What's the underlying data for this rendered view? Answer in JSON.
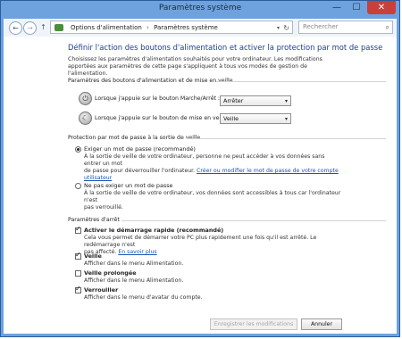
{
  "window": {
    "title": "Paramètres système",
    "minimize": "—",
    "maximize": "☐",
    "close": "✕"
  },
  "address": {
    "back": "←",
    "forward": "→",
    "up": "↑",
    "crumb1": "Options d'alimentation",
    "separator": "›",
    "crumb2": "Paramètres système",
    "dropdown": "▾",
    "refresh": "↻",
    "search_placeholder": "Rechercher",
    "search_icon": "⌕"
  },
  "page": {
    "heading": "Définir l'action des boutons d'alimentation et activer la protection par mot de passe",
    "intro": "Choisissez les paramètres d'alimentation souhaités pour votre ordinateur. Les modifications apportées aux paramètres de cette page s'appliquent à tous vos modes de gestion de l'alimentation."
  },
  "buttons_section": {
    "title": "Paramètres des boutons d'alimentation et de mise en veille",
    "power_label": "Lorsque j'appuie sur le bouton Marche/Arrêt :",
    "power_value": "Arrêter",
    "sleep_label": "Lorsque j'appuie sur le bouton de mise en veille :",
    "sleep_value": "Veille",
    "arrow": "▾",
    "power_icon": "⏻",
    "sleep_icon": "☾"
  },
  "password_section": {
    "title": "Protection par mot de passe à la sortie de veille",
    "opt1_title": "Exiger un mot de passe (recommandé)",
    "opt1_desc_line1": "À la sortie de veille de votre ordinateur, personne ne peut accéder à vos données sans entrer un mot",
    "opt1_desc_line2_pre": "de passe pour déverrouiller l'ordinateur. ",
    "opt1_link_part1": "Créer ou modifier le mot de passe de votre compte",
    "opt1_link_part2": "utilisateur",
    "opt2_title": "Ne pas exiger un mot de passe",
    "opt2_desc_line1": "À la sortie de veille de votre ordinateur, vos données sont accessibles à tous car l'ordinateur n'est",
    "opt2_desc_line2": "pas verrouillé."
  },
  "shutdown_section": {
    "title": "Paramètres d'arrêt",
    "fast_title": "Activer le démarrage rapide (recommandé)",
    "fast_desc_line1": "Cela vous permet de démarrer votre PC plus rapidement une fois qu'il est arrêté. Le redémarrage n'est",
    "fast_desc_line2_pre": "pas affecté. ",
    "fast_link": "En savoir plus",
    "veille_title": "Veille",
    "veille_desc": "Afficher dans le menu Alimentation.",
    "prolongee_title": "Veille prolongée",
    "prolongee_desc": "Afficher dans le menu Alimentation.",
    "verrouiller_title": "Verrouiller",
    "verrouiller_desc": "Afficher dans le menu d'avatar du compte."
  },
  "footer": {
    "save": "Enregistrer les modifications",
    "cancel": "Annuler"
  }
}
